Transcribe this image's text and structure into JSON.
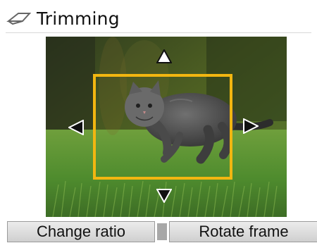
{
  "header": {
    "title": "Trimming",
    "icon": "trimming-icon"
  },
  "editor": {
    "frame_color": "#f2b611",
    "arrow_icons": [
      "arrow-up-icon",
      "arrow-down-icon",
      "arrow-left-icon",
      "arrow-right-icon"
    ]
  },
  "buttons": {
    "change_ratio_label": "Change ratio",
    "rotate_frame_label": "Rotate frame"
  }
}
